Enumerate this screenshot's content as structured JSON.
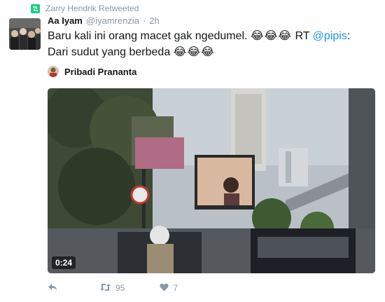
{
  "retweet_context": {
    "text": "Zarry Hendrik Retweeted",
    "icon": "retweet-badge-icon"
  },
  "tweet": {
    "author_name": "Aa Iyam",
    "author_handle": "@iyamrenzia",
    "separator": "·",
    "time": "2h",
    "text_part1": "Baru kali ini orang macet gak ngedumel. ",
    "emoji_run1": "😂😂😂",
    "text_part2": " RT ",
    "mention": "@pipis",
    "text_part3": ": Dari sudut yang berbeda ",
    "emoji_run2": "😂😂😂"
  },
  "media": {
    "attribution_name": "Pribadi Prananta",
    "duration": "0:24",
    "kind": "video"
  },
  "actions": {
    "reply_icon": "reply-icon",
    "retweet_icon": "retweet-icon",
    "retweet_count": "95",
    "like_icon": "heart-icon",
    "like_count": "7"
  },
  "colors": {
    "link": "#1b95e0",
    "muted": "#8899a6",
    "retweet_green": "#19cf86",
    "text": "#14171a"
  }
}
